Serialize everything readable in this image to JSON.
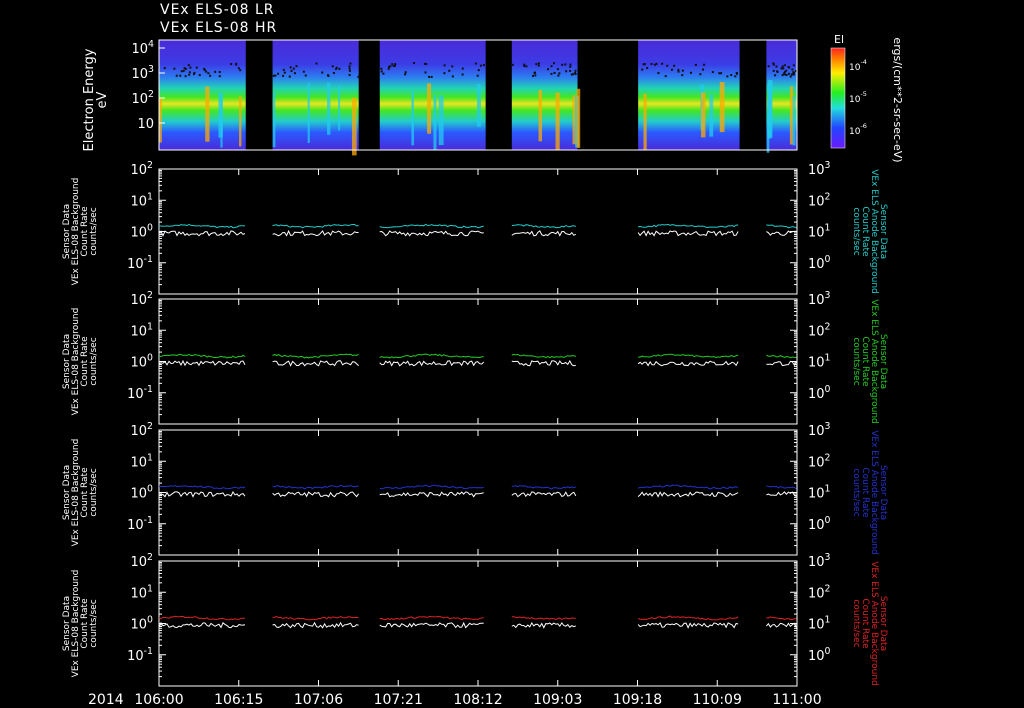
{
  "header": {
    "title_line1": "VEx ELS-08 LR",
    "title_line2": "VEx ELS-08 HR"
  },
  "colors": {
    "background": "#000000",
    "axis": "#ffffff",
    "trace_white": "#ffffff",
    "trace_cyan": "#22cccc",
    "trace_green": "#22cc22",
    "trace_blue": "#2233cc",
    "trace_red": "#dd2222"
  },
  "spectrogram": {
    "ylabel": "Electron Energy",
    "yunit": "eV",
    "yticks": [
      "10",
      "10",
      "10",
      "10"
    ],
    "ytick_exps": [
      "",
      "2",
      "3",
      "4"
    ],
    "colorbar": {
      "label": "El",
      "unit": "ergs/(cm**2-sr-sec-eV)",
      "ticks": [
        "10",
        "10",
        "10"
      ],
      "tick_exps": [
        "-4",
        "-5",
        "-6"
      ]
    }
  },
  "chart_data": [
    {
      "type": "line",
      "panel": "cyan",
      "ylabel_left": [
        "Sensor Data",
        "VEx ELS-08 Background",
        "Count Rate",
        "counts/sec"
      ],
      "ylabel_right": [
        "Sensor Data",
        "VEx ELS Anode Background",
        "Count Rate",
        "counts/sec"
      ],
      "yscale": "log",
      "ylim_left": [
        0.01,
        100
      ],
      "ylim_right": [
        0.1,
        1000
      ],
      "left_ticks": [
        "10^2",
        "10^1",
        "10^0",
        "10^-1"
      ],
      "right_ticks": [
        "10^3",
        "10^2",
        "10^1",
        "10^0"
      ],
      "series": [
        {
          "color": "cyan",
          "level": 1.5
        },
        {
          "color": "white",
          "level": 0.9
        }
      ]
    },
    {
      "type": "line",
      "panel": "green",
      "ylabel_left": [
        "Sensor Data",
        "VEx ELS-08 Background",
        "Count Rate",
        "counts/sec"
      ],
      "ylabel_right": [
        "Sensor Data",
        "VEx ELS Anode Background",
        "Count Rate",
        "counts/sec"
      ],
      "yscale": "log",
      "ylim_left": [
        0.01,
        100
      ],
      "ylim_right": [
        0.1,
        1000
      ],
      "left_ticks": [
        "10^2",
        "10^1",
        "10^0",
        "10^-1"
      ],
      "right_ticks": [
        "10^3",
        "10^2",
        "10^1",
        "10^0"
      ],
      "series": [
        {
          "color": "green",
          "level": 1.5
        },
        {
          "color": "white",
          "level": 0.9
        }
      ]
    },
    {
      "type": "line",
      "panel": "blue",
      "ylabel_left": [
        "Sensor Data",
        "VEx ELS-08 Background",
        "Count Rate",
        "counts/sec"
      ],
      "ylabel_right": [
        "Sensor Data",
        "VEx ELS Anode Background",
        "Count Rate",
        "counts/sec"
      ],
      "yscale": "log",
      "ylim_left": [
        0.01,
        100
      ],
      "ylim_right": [
        0.1,
        1000
      ],
      "left_ticks": [
        "10^2",
        "10^1",
        "10^0",
        "10^-1"
      ],
      "right_ticks": [
        "10^3",
        "10^2",
        "10^1",
        "10^0"
      ],
      "series": [
        {
          "color": "blue",
          "level": 1.5
        },
        {
          "color": "white",
          "level": 0.9
        }
      ]
    },
    {
      "type": "line",
      "panel": "red",
      "ylabel_left": [
        "Sensor Data",
        "VEx ELS-08 Background",
        "Count Rate",
        "counts/sec"
      ],
      "ylabel_right": [
        "Sensor Data",
        "VEx ELS Anode Background",
        "Count Rate",
        "counts/sec"
      ],
      "yscale": "log",
      "ylim_left": [
        0.01,
        100
      ],
      "ylim_right": [
        0.1,
        1000
      ],
      "left_ticks": [
        "10^2",
        "10^1",
        "10^0",
        "10^-1"
      ],
      "right_ticks": [
        "10^3",
        "10^2",
        "10^1",
        "10^0"
      ],
      "series": [
        {
          "color": "red",
          "level": 1.5
        },
        {
          "color": "white",
          "level": 0.9
        }
      ]
    }
  ],
  "time_axis": {
    "year": "2014",
    "ticks": [
      "106:00",
      "106:15",
      "107:06",
      "107:21",
      "108:12",
      "109:03",
      "109:18",
      "110:09",
      "111:00"
    ],
    "data_segments": [
      [
        0,
        0.136
      ],
      [
        0.178,
        0.313
      ],
      [
        0.346,
        0.512
      ],
      [
        0.553,
        0.656
      ],
      [
        0.751,
        0.91
      ],
      [
        0.952,
        1.0
      ]
    ]
  }
}
